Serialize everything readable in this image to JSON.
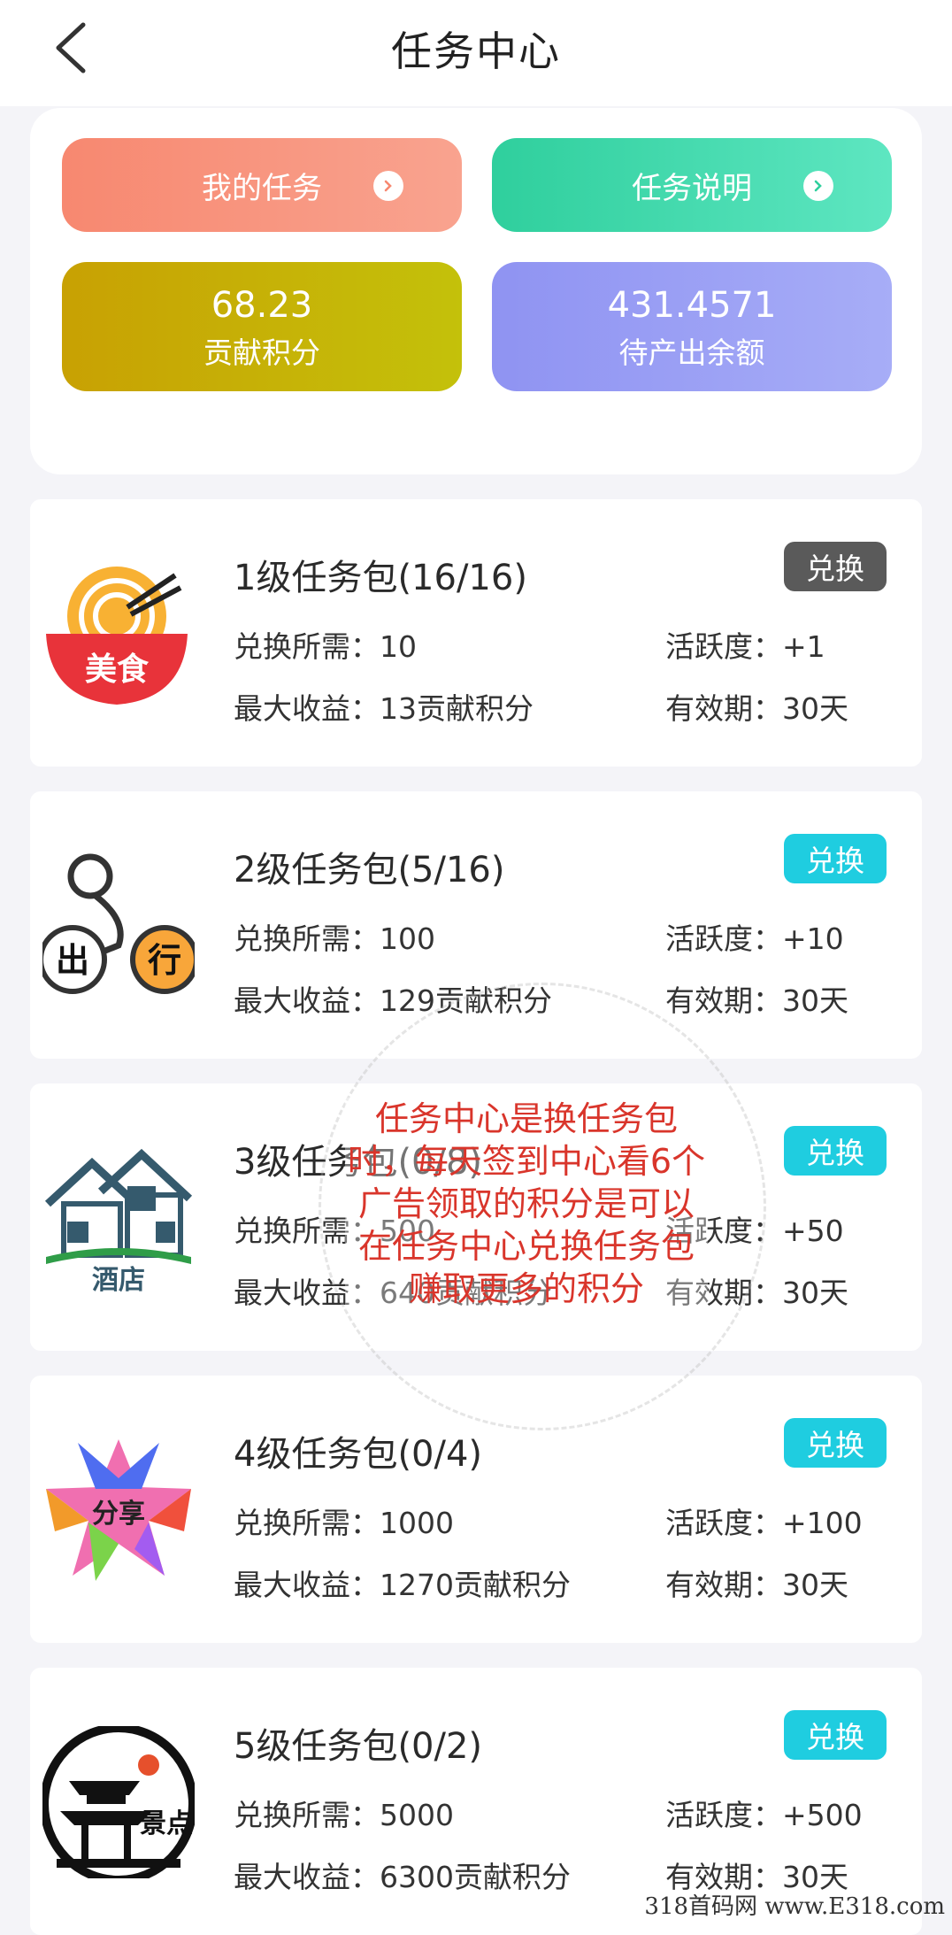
{
  "header": {
    "title": "任务中心"
  },
  "top": {
    "my_tasks": "我的任务",
    "task_desc": "任务说明",
    "stats": [
      {
        "value": "68.23",
        "label": "贡献积分"
      },
      {
        "value": "431.4571",
        "label": "待产出余额"
      }
    ]
  },
  "packages": [
    {
      "title": "1级任务包(16/16)",
      "button": "兑换",
      "cost": "兑换所需：10",
      "activity": "活跃度：+1",
      "max": "最大收益：13贡献积分",
      "valid": "有效期：30天",
      "logo_text": "美食",
      "state": "disabled"
    },
    {
      "title": "2级任务包(5/16)",
      "button": "兑换",
      "cost": "兑换所需：100",
      "activity": "活跃度：+10",
      "max": "最大收益：129贡献积分",
      "valid": "有效期：30天",
      "logo_text": "出行",
      "state": "active"
    },
    {
      "title": "3级任务包(0/8)",
      "button": "兑换",
      "cost": "兑换所需：500",
      "activity": "活跃度：+50",
      "max": "最大收益：640贡献积分",
      "valid": "有效期：30天",
      "logo_text": "酒店",
      "state": "active"
    },
    {
      "title": "4级任务包(0/4)",
      "button": "兑换",
      "cost": "兑换所需：1000",
      "activity": "活跃度：+100",
      "max": "最大收益：1270贡献积分",
      "valid": "有效期：30天",
      "logo_text": "分享",
      "state": "active"
    },
    {
      "title": "5级任务包(0/2)",
      "button": "兑换",
      "cost": "兑换所需：5000",
      "activity": "活跃度：+500",
      "max": "最大收益：6300贡献积分",
      "valid": "有效期：30天",
      "logo_text": "景点",
      "state": "active"
    }
  ],
  "overlay_note": "任务中心是换任务包时，每天签到中心看6个广告领取的积分是可以在任务中心兑换任务包赚取更多的积分",
  "site_mark": "318首码网 www.E318.com",
  "colors": {
    "active_button": "#1fcde0",
    "disabled_button": "#5a5a5a",
    "note_red": "#d9352b"
  },
  "icons": [
    "back-arrow-icon",
    "chevron-right-icon"
  ]
}
